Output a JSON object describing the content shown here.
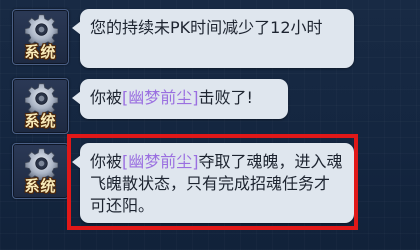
{
  "system_avatar": {
    "label": "系统",
    "icon": "gear-icon"
  },
  "messages": [
    {
      "text": "您的持续未PK时间减少了12小时"
    },
    {
      "prefix": "你被",
      "player_name": "[幽梦前尘]",
      "suffix": "击败了!"
    },
    {
      "prefix": "你被",
      "player_name": "[幽梦前尘]",
      "suffix": "夺取了魂魄，进入魂飞魄散状态，只有完成招魂任务才可还阳。"
    }
  ],
  "colors": {
    "bubble": "#dfe6ee",
    "player_name": "#9a6fe0",
    "highlight": "#e01818"
  }
}
